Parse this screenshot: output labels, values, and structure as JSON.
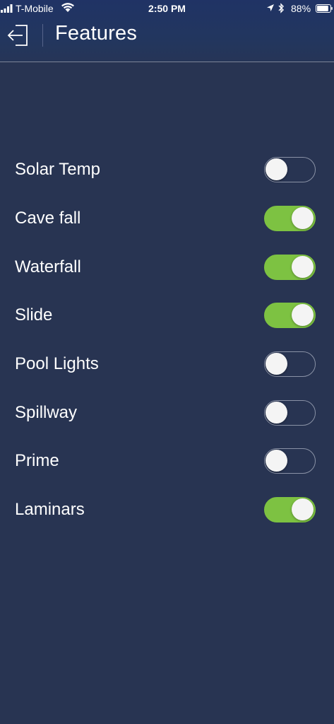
{
  "status_bar": {
    "carrier": "T-Mobile",
    "time": "2:50 PM",
    "battery": "88%",
    "battery_level": 0.88,
    "icons": [
      "signal-icon",
      "wifi-icon",
      "location-icon",
      "bluetooth-icon",
      "battery-icon"
    ]
  },
  "header": {
    "title": "Features",
    "back_icon": "exit-arrow-icon"
  },
  "features": [
    {
      "label": "Solar Temp",
      "on": false
    },
    {
      "label": "Cave fall",
      "on": true
    },
    {
      "label": "Waterfall",
      "on": true
    },
    {
      "label": "Slide",
      "on": true
    },
    {
      "label": "Pool Lights",
      "on": false
    },
    {
      "label": "Spillway",
      "on": false
    },
    {
      "label": "Prime",
      "on": false
    },
    {
      "label": "Laminars",
      "on": true
    }
  ],
  "colors": {
    "background": "#283452",
    "header": "#22365f",
    "toggle_on": "#7dc242",
    "toggle_off_border": "#8a92a6"
  }
}
